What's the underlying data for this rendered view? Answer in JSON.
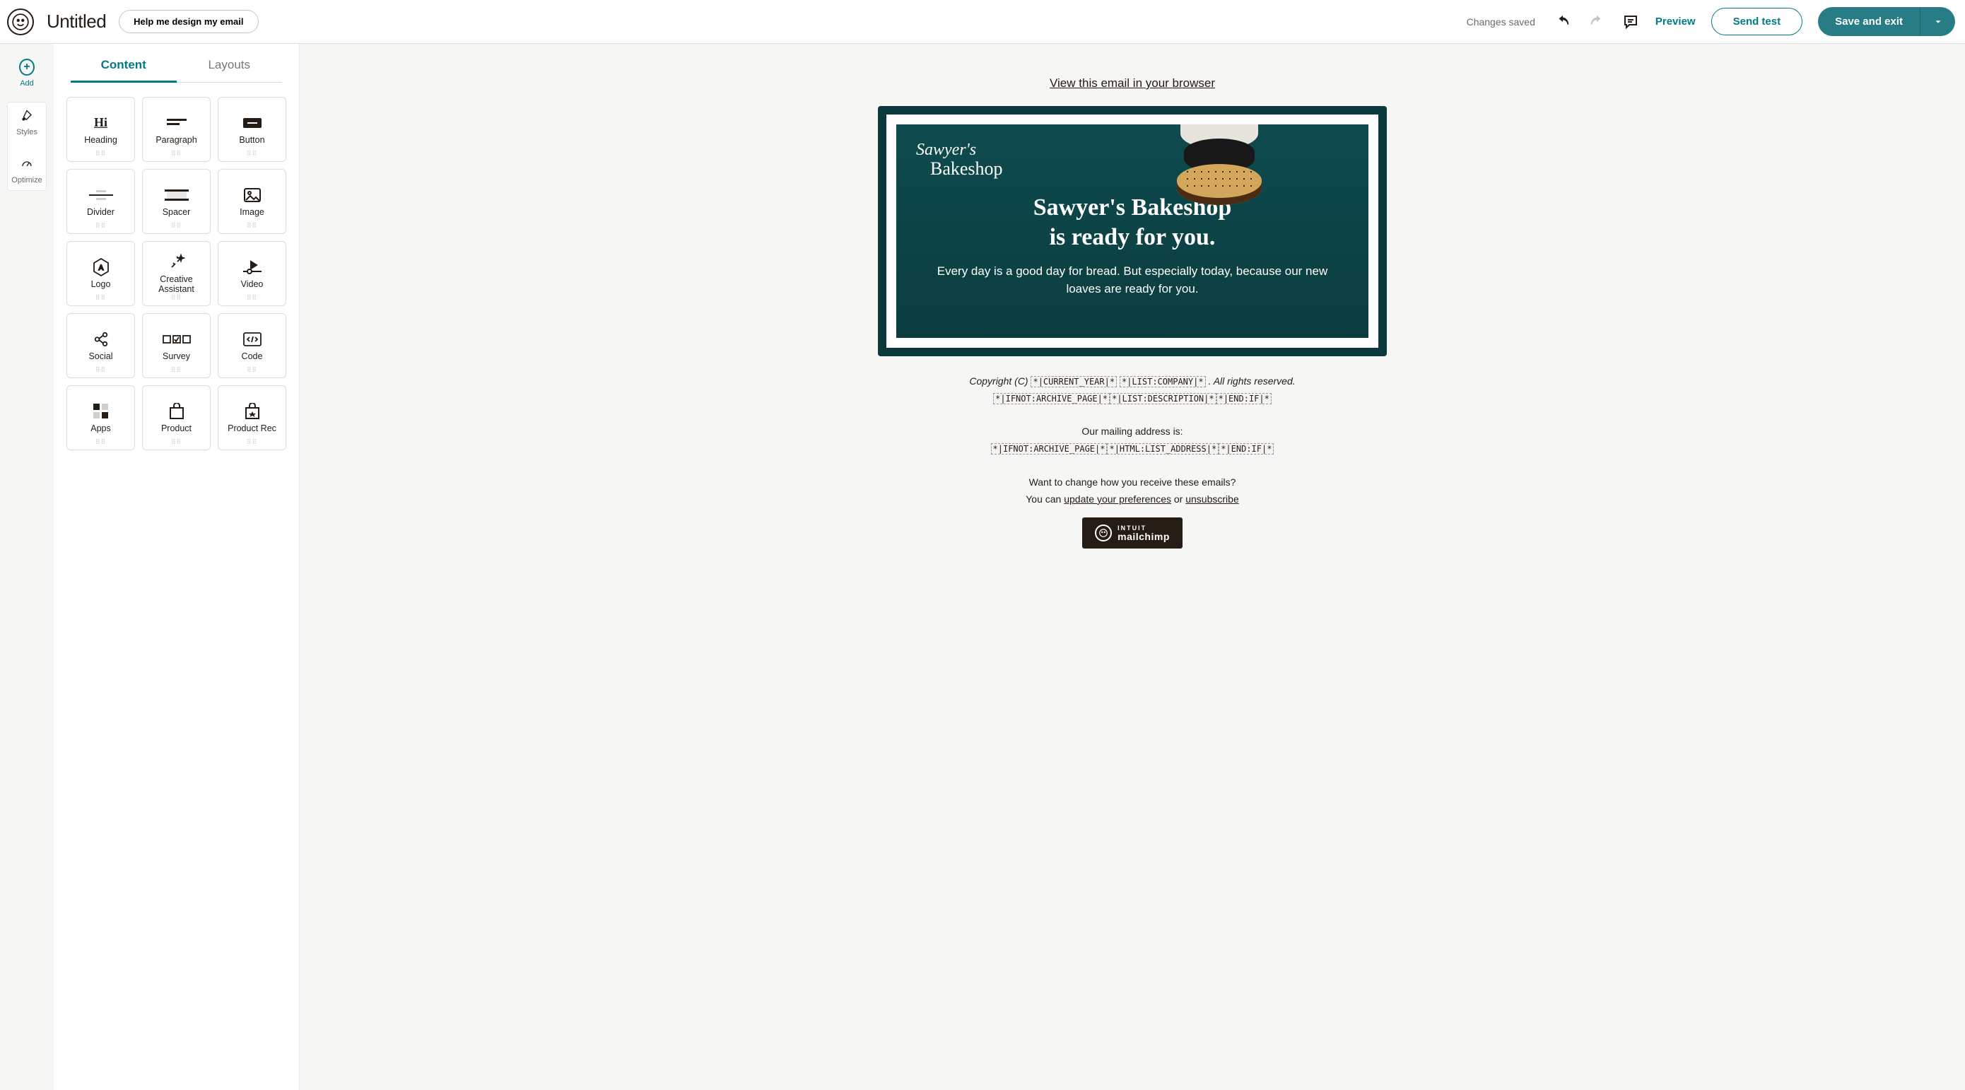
{
  "topbar": {
    "title": "Untitled",
    "help_label": "Help me design my email",
    "status": "Changes saved",
    "preview_label": "Preview",
    "send_test_label": "Send test",
    "save_exit_label": "Save and exit"
  },
  "rail": {
    "add": "Add",
    "styles": "Styles",
    "optimize": "Optimize"
  },
  "panel": {
    "tabs": {
      "content": "Content",
      "layouts": "Layouts"
    },
    "blocks": [
      {
        "id": "heading",
        "label": "Heading"
      },
      {
        "id": "paragraph",
        "label": "Paragraph"
      },
      {
        "id": "button",
        "label": "Button"
      },
      {
        "id": "divider",
        "label": "Divider"
      },
      {
        "id": "spacer",
        "label": "Spacer"
      },
      {
        "id": "image",
        "label": "Image"
      },
      {
        "id": "logo",
        "label": "Logo"
      },
      {
        "id": "creative",
        "label": "Creative\nAssistant"
      },
      {
        "id": "video",
        "label": "Video"
      },
      {
        "id": "social",
        "label": "Social"
      },
      {
        "id": "survey",
        "label": "Survey"
      },
      {
        "id": "code",
        "label": "Code"
      },
      {
        "id": "apps",
        "label": "Apps"
      },
      {
        "id": "product",
        "label": "Product"
      },
      {
        "id": "productrec",
        "label": "Product Rec"
      }
    ]
  },
  "email": {
    "view_link": "View this email in your browser",
    "logo_line1": "Sawyer's",
    "logo_line2": "Bakeshop",
    "hero_title_l1": "Sawyer's Bakeshop",
    "hero_title_l2": "is ready for you.",
    "hero_sub": "Every day is a good day for bread. But especially today, because our new loaves are ready for you.",
    "footer": {
      "copyright_prefix": "Copyright (C) ",
      "tag_year": "*|CURRENT_YEAR|*",
      "tag_company": "*|LIST:COMPANY|*",
      "rights": ". All rights reserved.",
      "tag_ifnot": "*|IFNOT:ARCHIVE_PAGE|*",
      "tag_listdesc": "*|LIST:DESCRIPTION|*",
      "tag_endif": "*|END:IF|*",
      "mailing_label": "Our mailing address is:",
      "tag_listaddr": "*|HTML:LIST_ADDRESS|*",
      "change_q": "Want to change how you receive these emails?",
      "you_can": "You can ",
      "update_link": "update your preferences",
      "or": " or ",
      "unsub_link": "unsubscribe",
      "badge_top": "INTUIT",
      "badge_bottom": "mailchimp"
    }
  }
}
